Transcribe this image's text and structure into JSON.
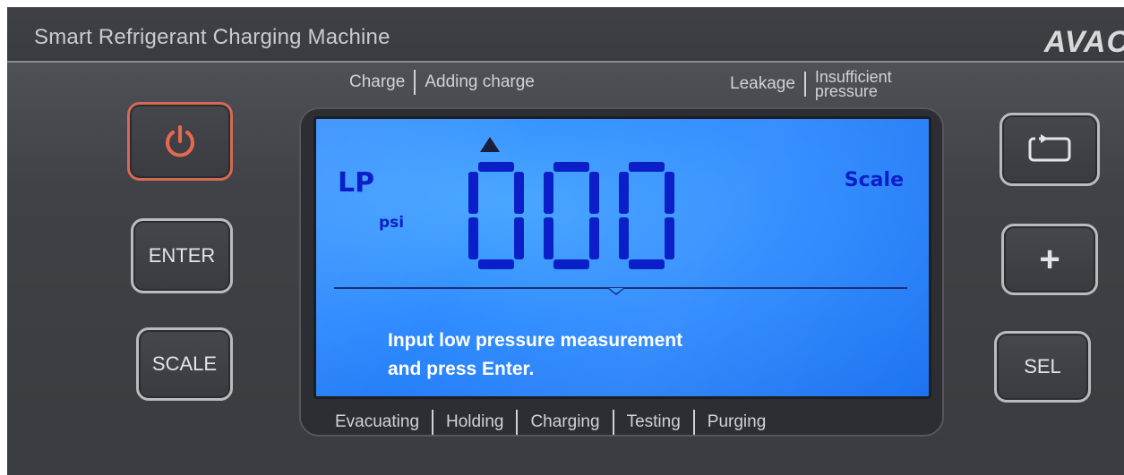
{
  "header": {
    "title": "Smart Refrigerant Charging Machine",
    "brand": "AVAC"
  },
  "top_labels": {
    "charge": "Charge",
    "adding_charge": "Adding charge",
    "leakage": "Leakage",
    "insufficient_line1": "Insufficient",
    "insufficient_line2": "pressure"
  },
  "lcd": {
    "mode": "LP",
    "unit": "psi",
    "source": "Scale",
    "digits": [
      "0",
      "0",
      "0"
    ],
    "message_line1": "Input low pressure measurement",
    "message_line2": "and press Enter.",
    "colors": {
      "background": "#2e8bff",
      "segment": "#0a1fc8",
      "message": "#ffffff"
    }
  },
  "bottom_labels": [
    "Evacuating",
    "Holding",
    "Charging",
    "Testing",
    "Purging"
  ],
  "buttons": {
    "power_icon": "power-icon",
    "enter": "ENTER",
    "scale": "SCALE",
    "cycle_icon": "cycle-icon",
    "plus": "+",
    "sel": "SEL"
  },
  "colors": {
    "panel": "#3f4146",
    "power_border": "#d46a55",
    "label_text": "#d0d2d6"
  }
}
